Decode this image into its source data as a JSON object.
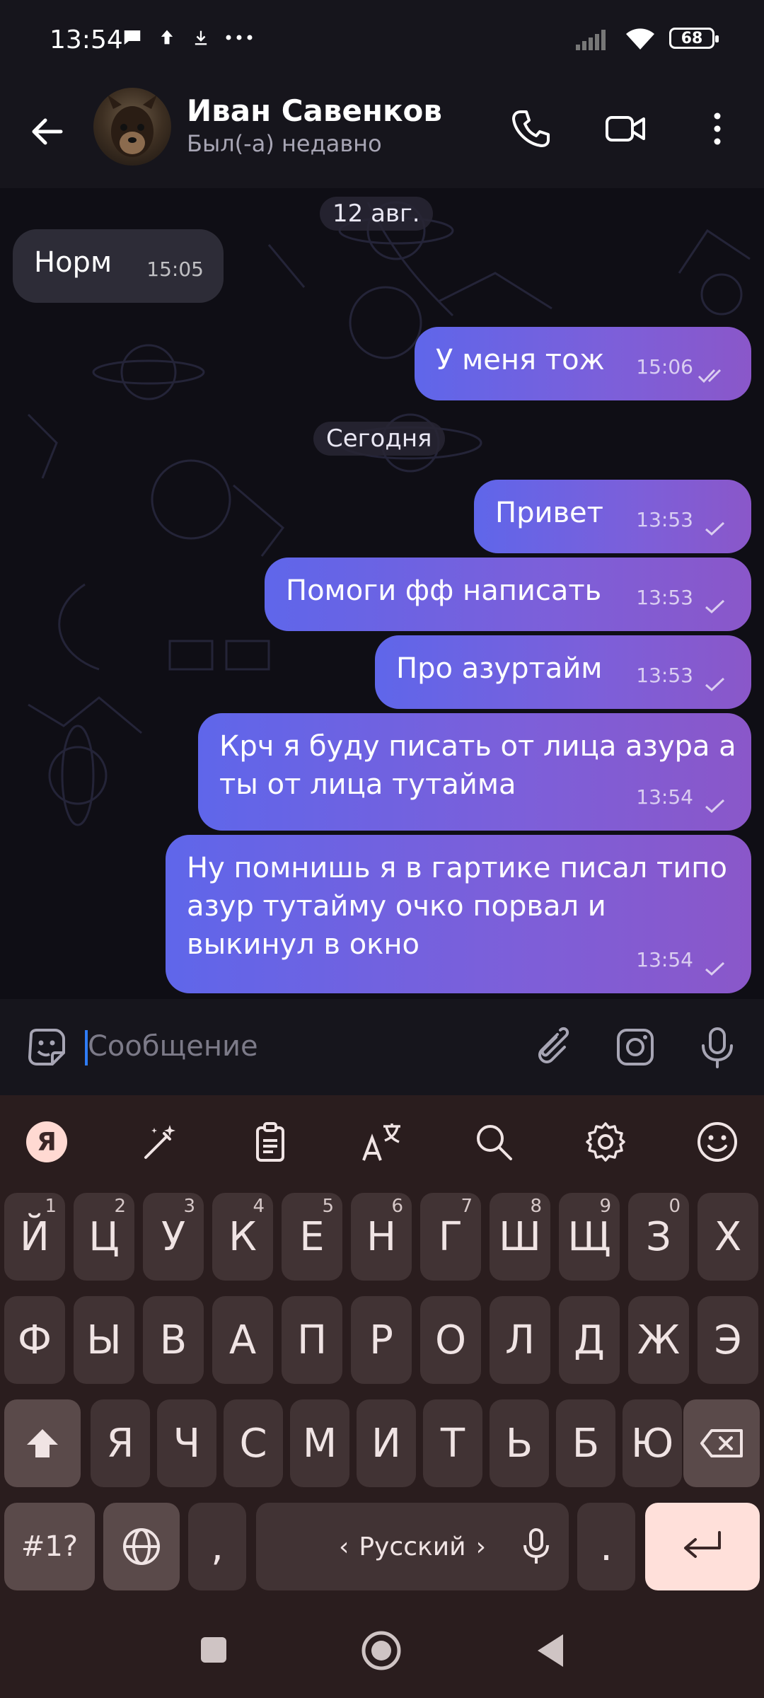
{
  "status_bar": {
    "time": "13:54",
    "battery": "68"
  },
  "contact": {
    "name": "Иван Савенков",
    "status": "Был(-а) недавно"
  },
  "messages": [
    {
      "type": "in",
      "text": "Норм",
      "time": "15:05"
    },
    {
      "type": "out",
      "text": "У меня тож",
      "time": "15:06"
    },
    {
      "type": "out",
      "text": "Привет",
      "time": "13:53"
    },
    {
      "type": "out",
      "text": "Помоги фф написать",
      "time": "13:53"
    },
    {
      "type": "out",
      "text": "Про азуртайм",
      "time": "13:53"
    },
    {
      "type": "out",
      "text": "Крч я буду писать от лица азура а\nты от лица тутайма",
      "time": "13:54"
    },
    {
      "type": "out",
      "text": "Ну помнишь я в гартике писал типо\nазур тутайму очко порвал и\nвыкинул в окно",
      "time": "13:54"
    }
  ],
  "date_separators": [
    "12 авг.",
    "Сегодня"
  ],
  "composer": {
    "placeholder": "Сообщение"
  },
  "keyboard": {
    "row1": [
      "Й",
      "Ц",
      "У",
      "К",
      "Е",
      "Н",
      "Г",
      "Ш",
      "Щ",
      "З",
      "Х"
    ],
    "row1_hints": [
      "1",
      "2",
      "3",
      "4",
      "5",
      "6",
      "7",
      "8",
      "9",
      "0",
      ""
    ],
    "row2": [
      "Ф",
      "Ы",
      "В",
      "А",
      "П",
      "Р",
      "О",
      "Л",
      "Д",
      "Ж",
      "Э"
    ],
    "row3": [
      "Я",
      "Ч",
      "С",
      "М",
      "И",
      "Т",
      "Ь",
      "Б",
      "Ю"
    ],
    "symbols_label": "#1?",
    "comma": ",",
    "period": ".",
    "space_label": "Русский",
    "toolbar_logo": "Я"
  },
  "colors": {
    "bubble_out_start": "#5f66ea",
    "bubble_out_end": "#8a57c9",
    "bubble_in": "#2d2c37",
    "keyboard_bg": "#2a1d1e",
    "enter_key": "#ffe0da"
  },
  "icons": [
    "back-arrow-icon",
    "phone-icon",
    "video-icon",
    "more-vert-icon",
    "sticker-icon",
    "attach-icon",
    "camera-icon",
    "mic-icon"
  ]
}
